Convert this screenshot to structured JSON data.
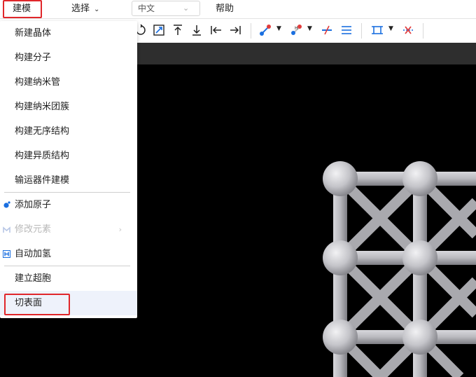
{
  "menubar": {
    "modeling": "建模",
    "select": "选择",
    "language": "中文",
    "help": "帮助"
  },
  "toolbar": {
    "icons": [
      "rotate-icon",
      "resize-icon",
      "move-up-icon",
      "move-down-icon",
      "move-left-icon",
      "move-right-icon",
      "bond-tool-icon",
      "bond-length-icon",
      "delete-bond-icon",
      "bond-style-icon",
      "cell-tool-icon",
      "remove-cell-icon"
    ]
  },
  "modeling_menu": {
    "items": [
      {
        "label": "新建晶体"
      },
      {
        "label": "构建分子"
      },
      {
        "label": "构建纳米管"
      },
      {
        "label": "构建纳米团簇"
      },
      {
        "label": "构建无序结构"
      },
      {
        "label": "构建异质结构"
      },
      {
        "label": "输运器件建模"
      },
      {
        "label": "添加原子"
      },
      {
        "label": "修改元素"
      },
      {
        "label": "自动加氢"
      },
      {
        "label": "建立超胞"
      },
      {
        "label": "切表面"
      }
    ]
  },
  "colors": {
    "accent_red": "#e0272b",
    "icon_blue": "#1a6fe0",
    "icon_red": "#e23b3b",
    "viewport_bg": "#000000",
    "atom": "#c8c8cc"
  }
}
